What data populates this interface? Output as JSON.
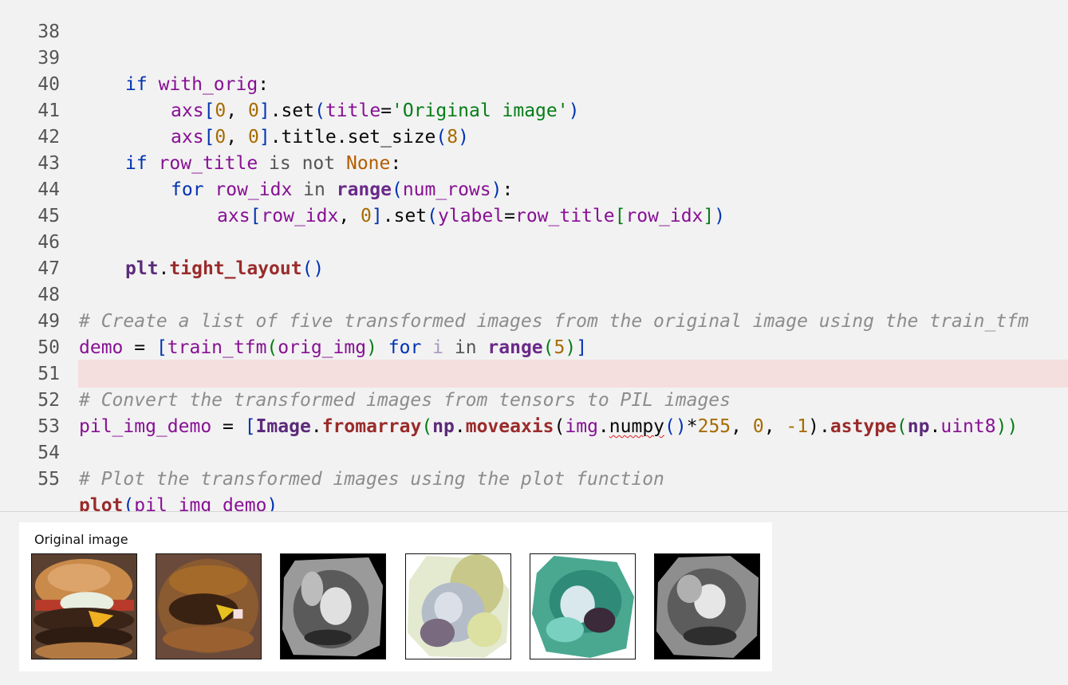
{
  "editor": {
    "lines": [
      {
        "n": "38"
      },
      {
        "n": "39"
      },
      {
        "n": "40"
      },
      {
        "n": "41"
      },
      {
        "n": "42"
      },
      {
        "n": "43"
      },
      {
        "n": "44"
      },
      {
        "n": "45"
      },
      {
        "n": "46"
      },
      {
        "n": "47"
      },
      {
        "n": "48"
      },
      {
        "n": "49"
      },
      {
        "n": "50"
      },
      {
        "n": "51"
      },
      {
        "n": "52"
      },
      {
        "n": "53"
      },
      {
        "n": "54"
      },
      {
        "n": "55"
      }
    ],
    "code": {
      "l39": {
        "if": "if",
        "var": "with_orig",
        "colon": ":"
      },
      "l40": {
        "axs": "axs",
        "b1": "[",
        "i0": "0",
        "comma": ", ",
        "i1": "0",
        "b2": "]",
        "dot": ".set",
        "p1": "(",
        "kw": "title",
        "eq": "=",
        "str": "'Original image'",
        "p2": ")"
      },
      "l41": {
        "axs": "axs",
        "b1": "[",
        "i0": "0",
        "comma": ", ",
        "i1": "0",
        "b2": "]",
        "rest": ".title.set_size",
        "p1": "(",
        "num": "8",
        "p2": ")"
      },
      "l42": {
        "if": "if",
        "var": "row_title",
        "is": " is not ",
        "none": "None",
        "colon": ":"
      },
      "l43": {
        "for": "for",
        "var": " row_idx",
        "in": " in ",
        "fn": "range",
        "p1": "(",
        "arg": "num_rows",
        "p2": ")",
        "colon": ":"
      },
      "l44": {
        "axs": "axs",
        "b1": "[",
        "v": "row_idx",
        "comma": ", ",
        "i0": "0",
        "b2": "]",
        "dot": ".set",
        "p1": "(",
        "kw": "ylabel",
        "eq": "=",
        "v2": "row_title",
        "b3": "[",
        "v3": "row_idx",
        "b4": "]",
        "p2": ")"
      },
      "l46": {
        "plt": "plt",
        "dot": ".",
        "fn": "tight_layout",
        "p": "()"
      },
      "l48": {
        "comment": "# Create a list of five transformed images from the original image using the train_tfm"
      },
      "l49": {
        "v": "demo",
        "eq": " = ",
        "b1": "[",
        "fn": "train_tfm",
        "p1": "(",
        "arg": "orig_img",
        "p2": ")",
        "for": " for ",
        "i": "i",
        "in": " in ",
        "range": "range",
        "p3": "(",
        "num": "5",
        "p4": ")",
        "b2": "]"
      },
      "l51": {
        "comment": "# Convert the transformed images from tensors to PIL images"
      },
      "l52": {
        "v": "pil_img_demo",
        "eq": " = ",
        "b1": "[",
        "cls": "Image",
        "d1": ".",
        "fn1": "fromarray",
        "p1": "(",
        "np": "np",
        "d2": ".",
        "fn2": "moveaxis",
        "p2": "(",
        "img": "img",
        "d3": ".",
        "numpy": "numpy",
        "pp": "()",
        "mul": "*",
        "n255": "255",
        "c1": ", ",
        "n0": "0",
        "c2": ", ",
        "nm1": "-1",
        "p3": ")",
        "d4": ".",
        "fn3": "astype",
        "p4": "(",
        "np2": "np",
        "d5": ".",
        "u8": "uint8",
        "p5": "))"
      },
      "l54": {
        "comment": "# Plot the transformed images using the plot function"
      },
      "l55": {
        "fn": "plot",
        "p1": "(",
        "arg": "pil_img_demo",
        "p2": ")"
      }
    }
  },
  "output": {
    "figure_title": "Original image",
    "thumbnails": [
      {
        "label": "original-burger"
      },
      {
        "label": "transformed-color-jitter"
      },
      {
        "label": "transformed-grayscale-rotated"
      },
      {
        "label": "transformed-pale-rotated"
      },
      {
        "label": "transformed-teal-rotated"
      },
      {
        "label": "transformed-grayscale-rotated-2"
      }
    ]
  },
  "colors": {
    "background": "#f2f2f2",
    "keyword": "#0033b3",
    "variable": "#871094",
    "function": "#9a2b2b",
    "string": "#067d17",
    "comment": "#8c8c8c",
    "highlight_line": "#f5dede"
  }
}
